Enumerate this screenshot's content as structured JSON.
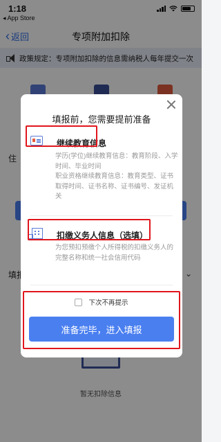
{
  "status_bar": {
    "time": "1:18",
    "back_to_app": "◂ App Store"
  },
  "nav": {
    "back_label": "返回",
    "title": "专项附加扣除"
  },
  "policy_banner": {
    "icon": "speaker-icon",
    "text": "政策规定：专项附加扣除的信息需纳税人每年提交一次"
  },
  "background": {
    "row_label": "填报",
    "left_edge_text": "住",
    "empty_text": "暂无扣除信息"
  },
  "modal": {
    "heading": "填报前，您需要提前准备",
    "close_icon": "close-icon",
    "sections": [
      {
        "icon": "id-card-icon",
        "title": "继续教育信息",
        "desc1": "学历(学位)继续教育信息：教育阶段、入学时间、毕业时间",
        "desc2": "职业资格继续教育信息：教育类型、证书取得时间、证书名称、证书编号、发证机关"
      },
      {
        "icon": "building-icon",
        "title": "扣缴义务人信息（选填）",
        "desc": "为您预扣预缴个人所得税的扣缴义务人的完整名称和统一社会信用代码"
      }
    ],
    "checkbox_label": "下次不再提示",
    "confirm_button": "准备完毕，进入填报"
  },
  "colors": {
    "accent": "#4a7ff0",
    "highlight": "#e0161c",
    "banner_bg": "#e8edf7"
  }
}
